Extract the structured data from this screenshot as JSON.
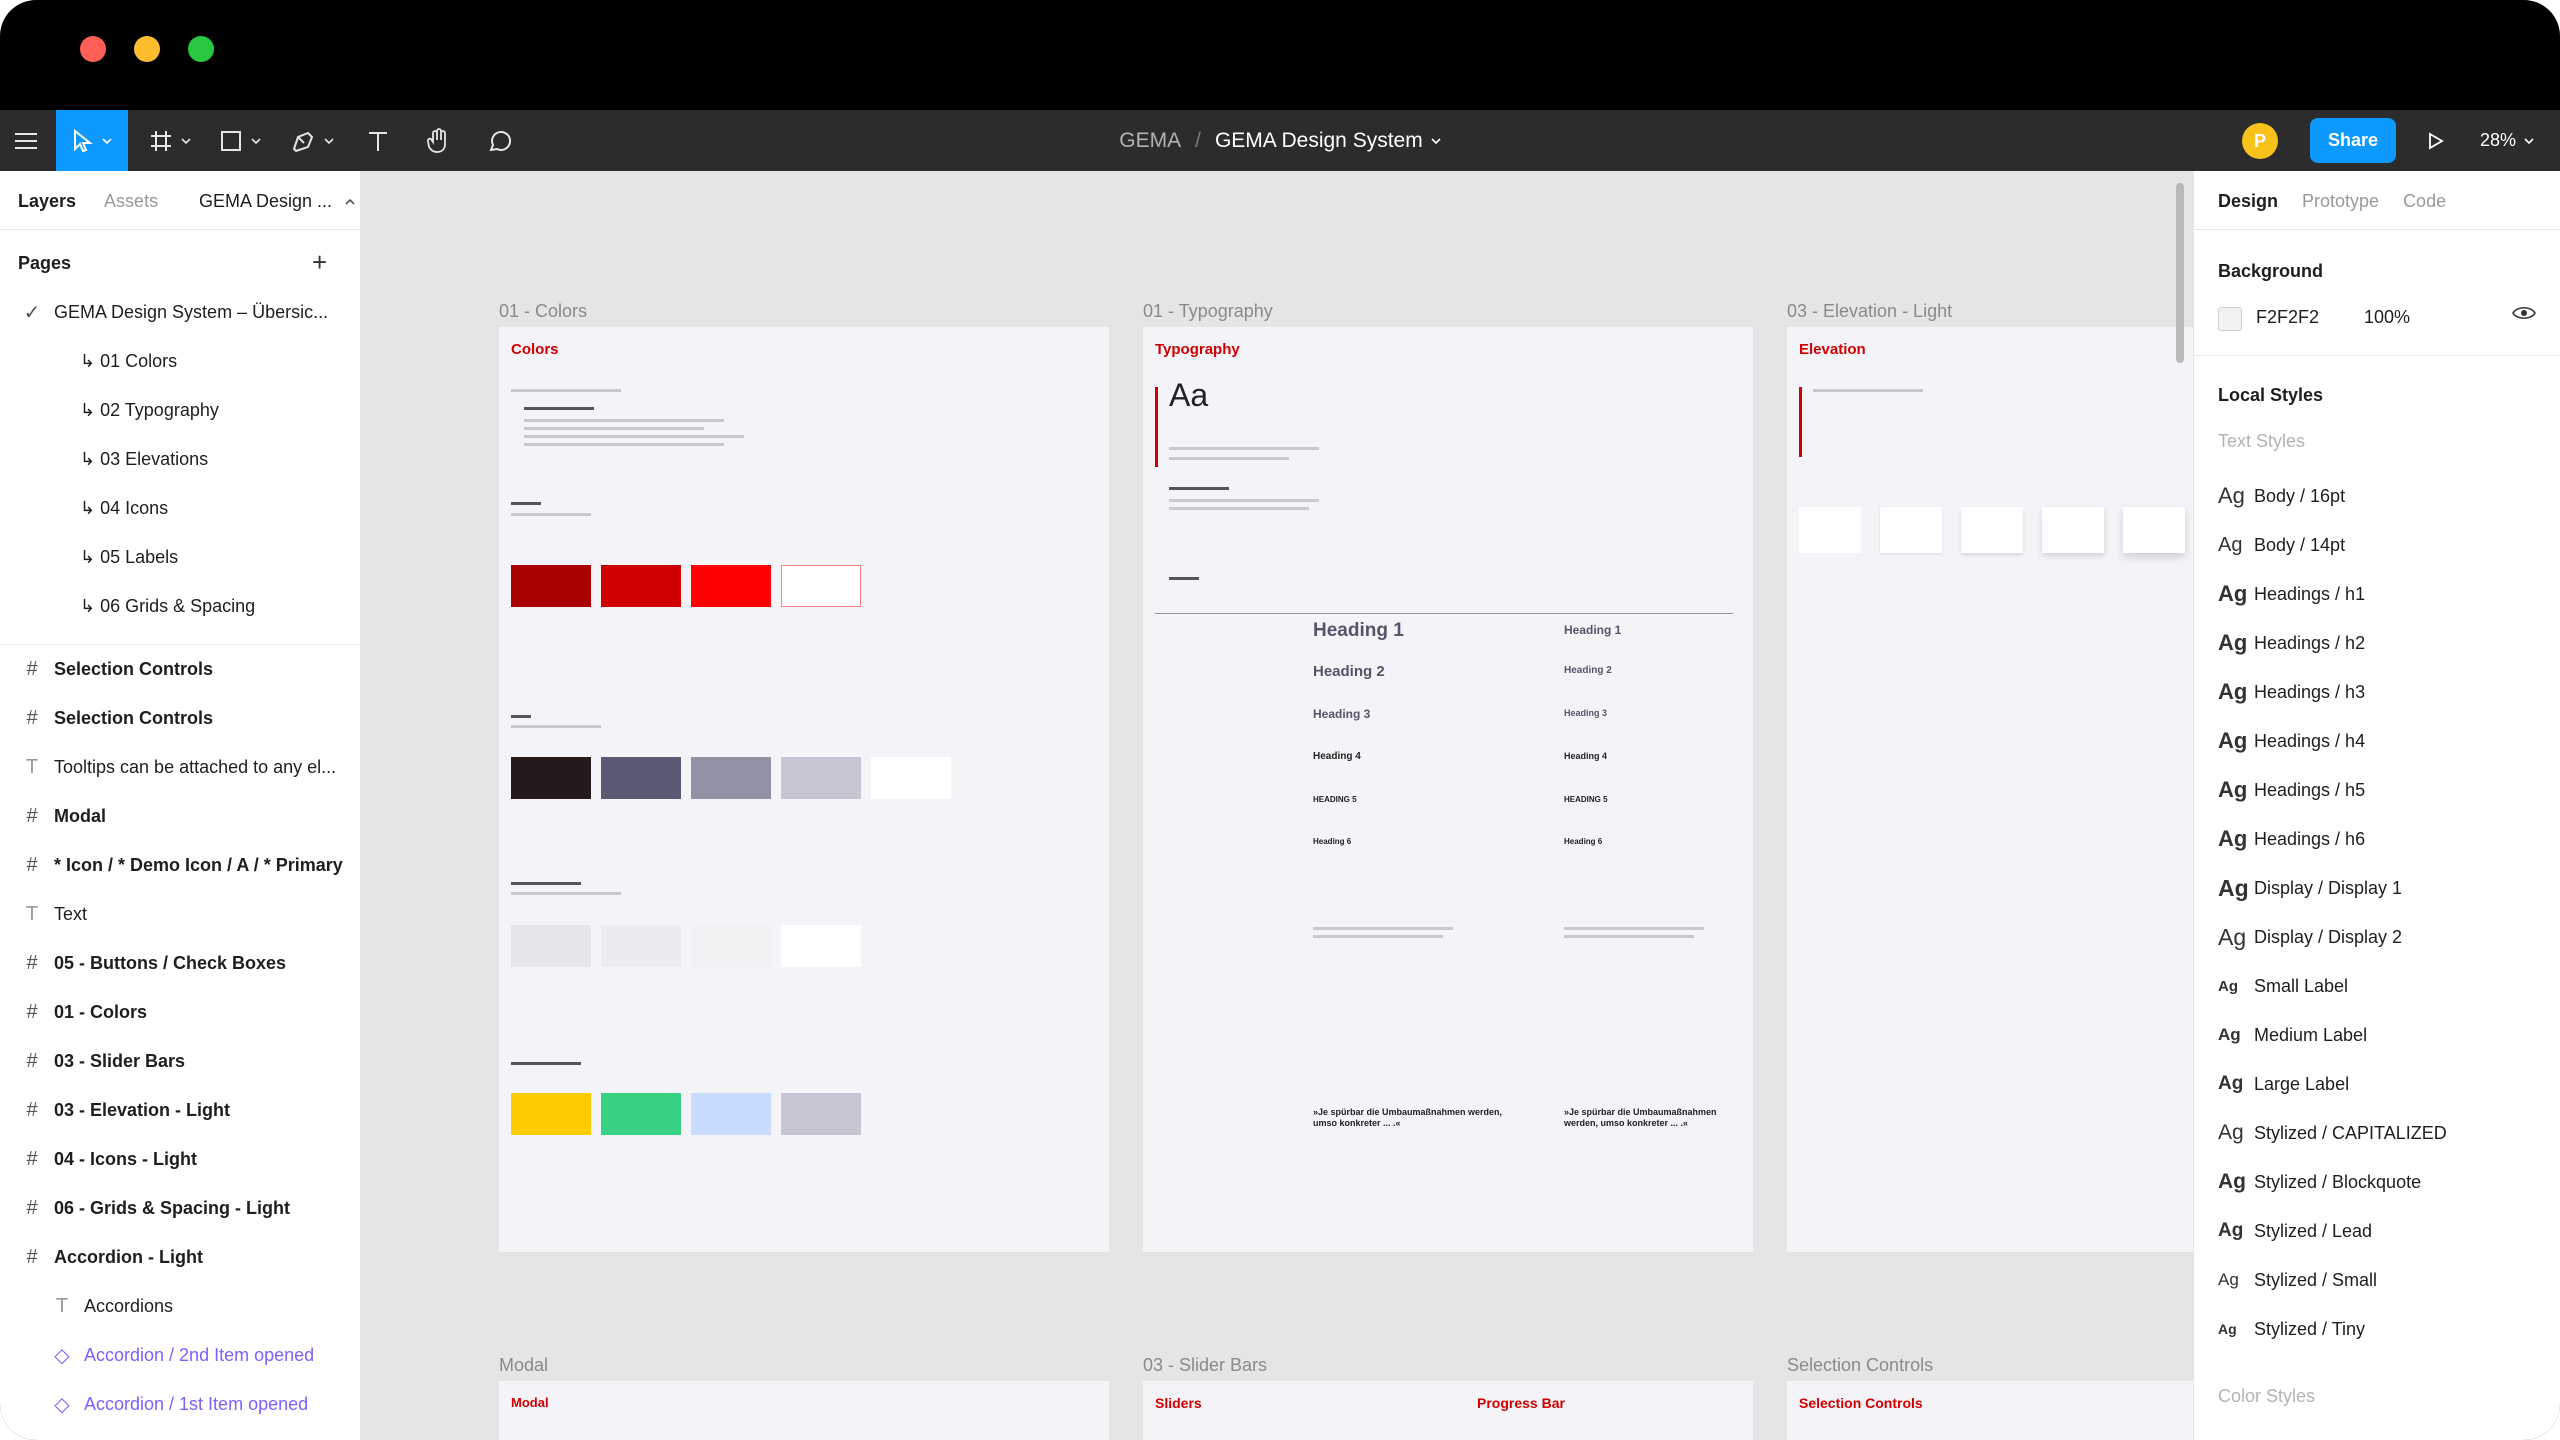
{
  "toolbar": {
    "project": "GEMA",
    "separator": "/",
    "file_name": "GEMA Design System",
    "avatar_initial": "P",
    "share_label": "Share",
    "zoom": "28%"
  },
  "left_panel": {
    "tabs": [
      "Layers",
      "Assets"
    ],
    "page_picker": "GEMA Design ...",
    "pages_label": "Pages",
    "pages": [
      "GEMA Design System – Übersic...",
      "01 Colors",
      "02 Typography",
      "03 Elevations",
      "04 Icons",
      "05 Labels",
      "06 Grids & Spacing"
    ],
    "layers": [
      {
        "label": "Selection Controls",
        "kind": "frame"
      },
      {
        "label": "Selection Controls",
        "kind": "frame"
      },
      {
        "label": "Tooltips can be attached to any el...",
        "kind": "text"
      },
      {
        "label": "Modal",
        "kind": "frame"
      },
      {
        "label": "* Icon / * Demo Icon / A / * Primary",
        "kind": "frame"
      },
      {
        "label": "Text",
        "kind": "text"
      },
      {
        "label": "05 - Buttons / Check Boxes",
        "kind": "frame"
      },
      {
        "label": "01 - Colors",
        "kind": "frame"
      },
      {
        "label": "03 - Slider Bars",
        "kind": "frame"
      },
      {
        "label": "03 - Elevation - Light",
        "kind": "frame"
      },
      {
        "label": "04 - Icons - Light",
        "kind": "frame"
      },
      {
        "label": "06 - Grids & Spacing - Light",
        "kind": "frame"
      },
      {
        "label": "Accordion - Light",
        "kind": "frame"
      },
      {
        "label": "Accordions",
        "kind": "text"
      },
      {
        "label": "Accordion / 2nd Item opened",
        "kind": "component"
      },
      {
        "label": "Accordion / 1st Item opened",
        "kind": "component"
      }
    ]
  },
  "canvas": {
    "frames": [
      {
        "label": "01 - Colors",
        "title": "Colors"
      },
      {
        "label": "01 - Typography",
        "title": "Typography"
      },
      {
        "label": "03 - Elevation - Light",
        "title": "Elevation"
      },
      {
        "label": "Modal",
        "title": "Modal"
      },
      {
        "label": "03 - Slider Bars",
        "title": "Sliders",
        "title2": "Progress Bar"
      },
      {
        "label": "Selection Controls",
        "title": "Selection Controls"
      }
    ],
    "typography_sample": "Aa",
    "headings": [
      "Heading 1",
      "Heading 2",
      "Heading 3",
      "Heading 4",
      "HEADING 5",
      "Heading 6"
    ],
    "quote": "»Je spürbar die Umbaumaßnahmen werden, umso konkreter ... .«",
    "colors": {
      "primary": [
        "#a80000",
        "#d00000",
        "#ff0000",
        "#ffffff"
      ],
      "text": [
        "#231b1b",
        "#5a5a72",
        "#9292a6",
        "#c6c6d2",
        "#ffffff"
      ],
      "background": [
        "#e5e5ea",
        "#ececf0",
        "#f2f2f5",
        "#ffffff"
      ],
      "denotive": [
        "#ffcc00",
        "#37d183",
        "#c9dcff",
        "#c6c6d2"
      ]
    }
  },
  "right_panel": {
    "tabs": [
      "Design",
      "Prototype",
      "Code"
    ],
    "background_label": "Background",
    "background_hex": "F2F2F2",
    "background_opacity": "100%",
    "local_styles_label": "Local Styles",
    "text_styles_label": "Text Styles",
    "text_styles": [
      "Body / 16pt",
      "Body / 14pt",
      "Headings / h1",
      "Headings / h2",
      "Headings / h3",
      "Headings / h4",
      "Headings / h5",
      "Headings / h6",
      "Display / Display 1",
      "Display / Display 2",
      "Small Label",
      "Medium Label",
      "Large Label",
      "Stylized / CAPITALIZED",
      "Stylized / Blockquote",
      "Stylized / Lead",
      "Stylized / Small",
      "Stylized / Tiny"
    ],
    "style_glyph": "Ag",
    "color_styles_label": "Color Styles"
  }
}
